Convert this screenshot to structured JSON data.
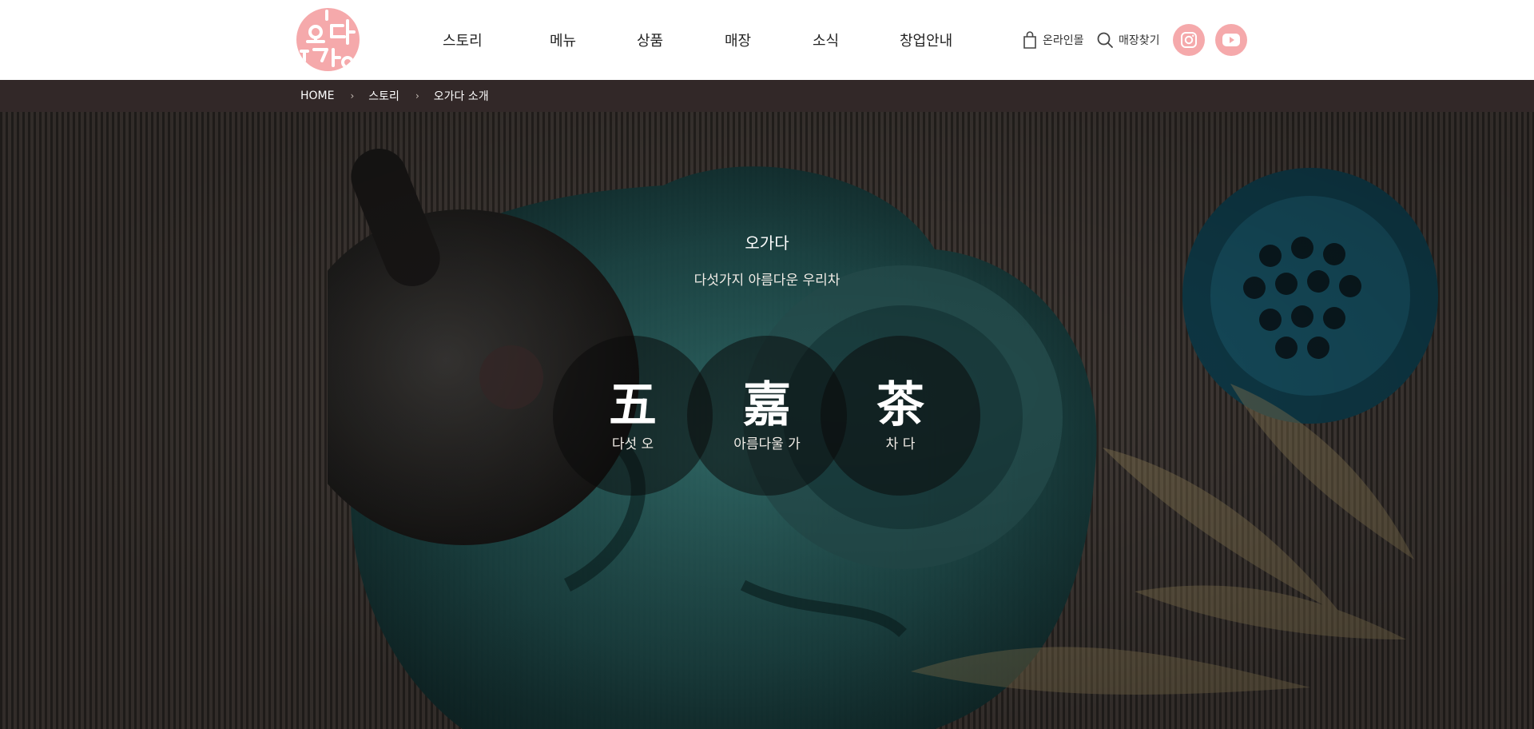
{
  "header": {
    "logo_text": "오가다",
    "nav": [
      {
        "label": "스토리"
      },
      {
        "label": "메뉴"
      },
      {
        "label": "상품"
      },
      {
        "label": "매장"
      },
      {
        "label": "소식"
      },
      {
        "label": "창업안내"
      }
    ],
    "util": {
      "online_mall": "온라인몰",
      "store_finder": "매장찾기"
    },
    "sns": {
      "instagram_icon": "instagram-icon",
      "youtube_icon": "youtube-icon"
    }
  },
  "breadcrumb": {
    "items": [
      "HOME",
      "스토리",
      "오가다 소개"
    ]
  },
  "hero": {
    "title": "오가다",
    "subtitle": "다섯가지 아름다운 우리차",
    "circles": [
      {
        "hanja": "五",
        "label": "다섯 오"
      },
      {
        "hanja": "嘉",
        "label": "아름다울 가"
      },
      {
        "hanja": "茶",
        "label": "차 다"
      }
    ]
  },
  "colors": {
    "brand_pink": "#f5a9ab",
    "breadcrumb_bg": "#322828",
    "hero_bg": "#3a332f"
  }
}
